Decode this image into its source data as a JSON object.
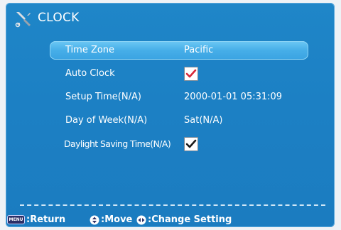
{
  "header": {
    "title": "CLOCK",
    "icon": "tools-icon"
  },
  "settings": [
    {
      "label": "Time Zone",
      "value": "Pacific",
      "selected": true
    },
    {
      "label": "Auto Clock",
      "checkbox": true,
      "checked": true,
      "check_color": "#d62839"
    },
    {
      "label": "Setup Time(N/A)",
      "value": "2000-01-01 05:31:09"
    },
    {
      "label": "Day of Week(N/A)",
      "value": "Sat(N/A)"
    },
    {
      "label": "Daylight Saving Time(N/A)",
      "checkbox": true,
      "checked": true,
      "check_color": "#1a1a1a"
    }
  ],
  "footer": {
    "menu_key": "MENU",
    "return_label": ":Return",
    "move_label": ":Move",
    "change_label": ":Change Setting"
  },
  "colors": {
    "panel": "#1f86c8",
    "highlight": "#46aee8",
    "text": "#ffffff"
  }
}
